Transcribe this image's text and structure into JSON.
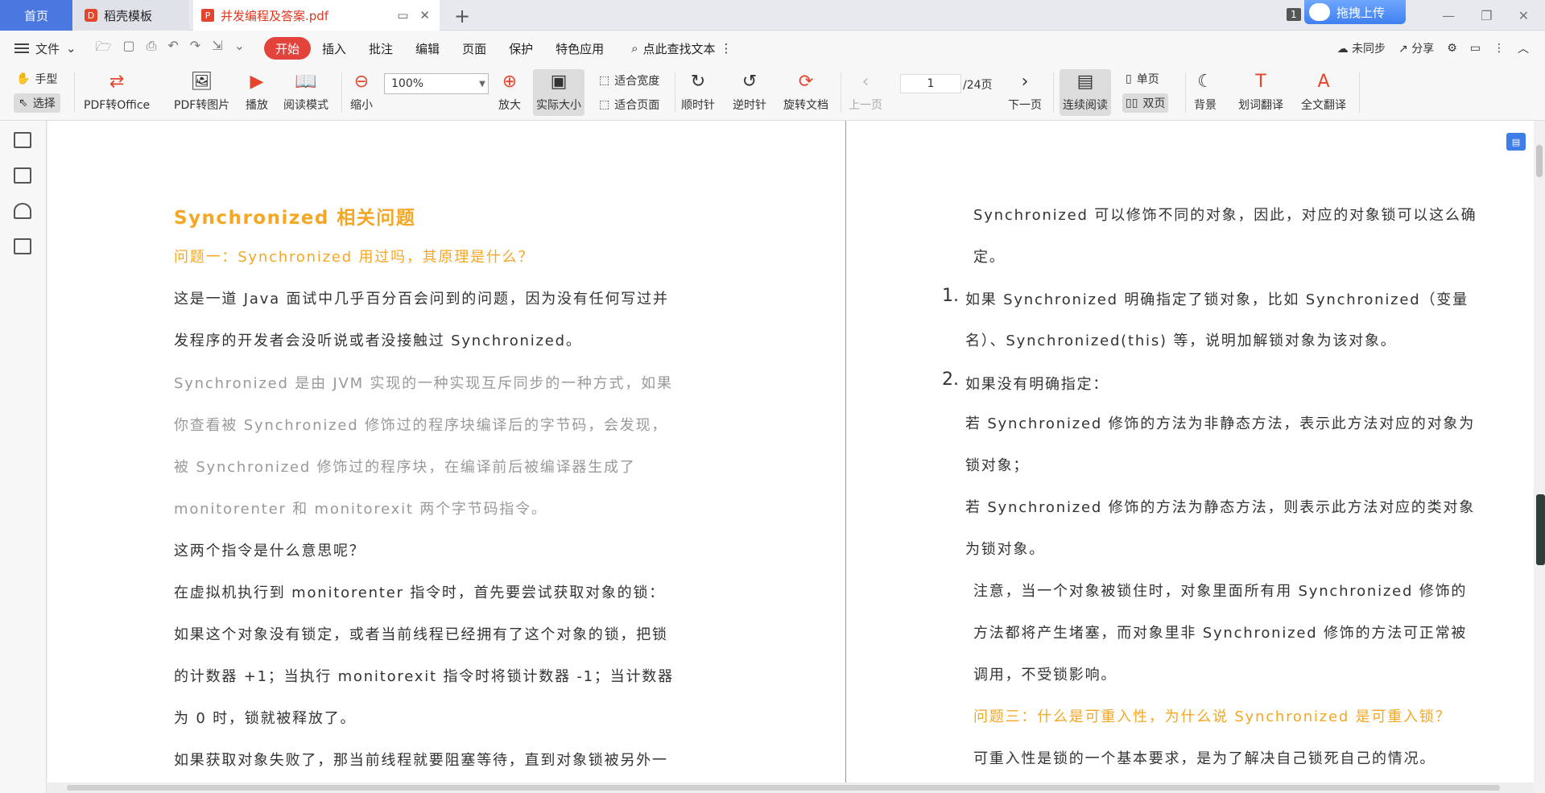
{
  "tabs": {
    "home": "首页",
    "template": "稻壳模板",
    "pdf": "并发编程及答案.pdf"
  },
  "titlebar": {
    "badge": "1",
    "upload": "拖拽上传"
  },
  "menubar": {
    "file": "文件",
    "items": [
      "开始",
      "插入",
      "批注",
      "编辑",
      "页面",
      "保护",
      "特色应用"
    ],
    "search": "点此查找文本",
    "sync": "未同步",
    "share": "分享"
  },
  "toolbar": {
    "hand": "手型",
    "select": "选择",
    "pdf_to_office": "PDF转Office",
    "pdf_to_image": "PDF转图片",
    "play": "播放",
    "read_mode": "阅读模式",
    "zoom_out": "缩小",
    "zoom_value": "100%",
    "zoom_in": "放大",
    "actual_size": "实际大小",
    "fit_width": "适合宽度",
    "fit_page": "适合页面",
    "rotate_cw": "顺时针",
    "rotate_ccw": "逆时针",
    "rotate_doc": "旋转文档",
    "prev_page": "上一页",
    "page_current": "1",
    "page_total": "/24页",
    "next_page": "下一页",
    "continuous": "连续阅读",
    "single": "单页",
    "double": "双页",
    "background": "背景",
    "word_translate": "划词翻译",
    "full_translate": "全文翻译"
  },
  "left_page": {
    "heading": "Synchronized  相关问题",
    "q1": "问题一：Synchronized  用过吗，其原理是什么？",
    "p1_l1": "这是一道   Java   面试中几乎百分百会问到的问题，因为没有任何写过并",
    "p1_l2": "发程序的开发者会没听说或者没接触过  Synchronized。",
    "g_l1": "Synchronized   是由   JVM   实现的一种实现互斥同步的一种方式，如果",
    "g_l2": "你查看被     Synchronized     修饰过的程序块编译后的字节码，会发现，",
    "g_l3": "被        Synchronized        修饰过的程序块，在编译前后被编译器生成了",
    "g_l4": " monitorenter  和  monitorexit  两个字节码指令。",
    "p2": "这两个指令是什么意思呢？",
    "p3": "在虚拟机执行到  monitorenter  指令时，首先要尝试获取对象的锁：",
    "p4_l1": "如果这个对象没有锁定，或者当前线程已经拥有了这个对象的锁，把锁",
    "p4_l2": "的计数器     +1；当执行  monitorexit  指令时将锁计数器    -1；当计数器",
    "p4_l3": "为   0  时，锁就被释放了。",
    "p5": "如果获取对象失败了，那当前线程就要阻塞等待，直到对象锁被另外一"
  },
  "right_page": {
    "r1_l1": "Synchronized  可以修饰不同的对象，因此，对应的对象锁可以这么确",
    "r1_l2": "定。",
    "n1": "1.",
    "n1_l1": "如果  Synchronized  明确指定了锁对象，比如  Synchronized（变量",
    "n1_l2": "名）、Synchronized(this)  等，说明加解锁对象为该对象。",
    "n2": "2.",
    "n2_l1": "如果没有明确指定：",
    "a1_l1": "若    Synchronized    修饰的方法为非静态方法，表示此方法对应的对象为",
    "a1_l2": "锁对象；",
    "a2_l1": "若    Synchronized    修饰的方法为静态方法，则表示此方法对应的类对象",
    "a2_l2": "为锁对象。",
    "note_l1": "注意，当一个对象被锁住时，对象里面所有用     Synchronized     修饰的",
    "note_l2": "方法都将产生堵塞，而对象里非     Synchronized    修饰的方法可正常被",
    "note_l3": "调用，不受锁影响。",
    "q3": "问题三：什么是可重入性，为什么说  Synchronized  是可重入锁？",
    "r_last": "可重入性是锁的一个基本要求，是为了解决自己锁死自己的情况。"
  },
  "colors": {
    "accent": "#e3433a",
    "heading_orange": "#f5a623",
    "grey_text": "#999999",
    "home_tab": "#4a78e0"
  }
}
